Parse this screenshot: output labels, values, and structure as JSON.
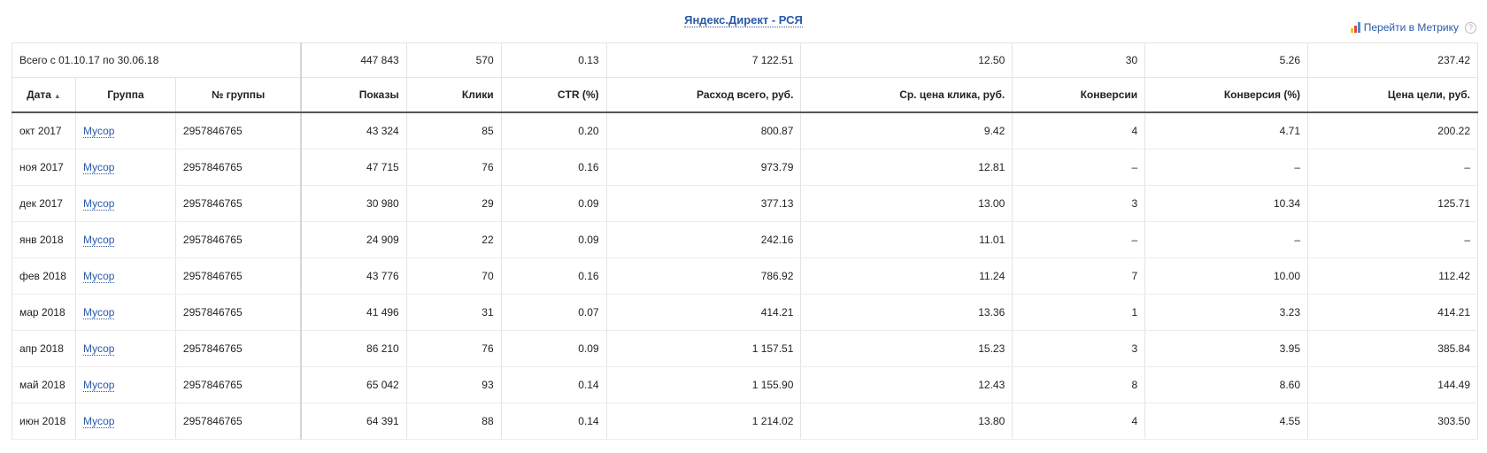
{
  "title": "Яндекс.Директ - РСЯ",
  "metrika_link": "Перейти в Метрику",
  "metrika_colors": [
    "#f0c419",
    "#e34a33",
    "#4b8bd6"
  ],
  "summary": {
    "label": "Всего с 01.10.17 по 30.06.18",
    "impressions": "447 843",
    "clicks": "570",
    "ctr": "0.13",
    "spend": "7 122.51",
    "avg_cpc": "12.50",
    "conversions": "30",
    "conversion_rate": "5.26",
    "cost_per_goal": "237.42"
  },
  "columns": {
    "date": "Дата",
    "date_sort": "▲",
    "group": "Группа",
    "group_id": "№ группы",
    "impressions": "Показы",
    "clicks": "Клики",
    "ctr": "CTR (%)",
    "spend": "Расход всего, руб.",
    "avg_cpc": "Ср. цена клика, руб.",
    "conversions": "Конверсии",
    "conversion_rate": "Конверсия (%)",
    "cost_per_goal": "Цена цели, руб."
  },
  "rows": [
    {
      "date": "окт 2017",
      "group": "Мусор",
      "group_id": "2957846765",
      "impressions": "43 324",
      "clicks": "85",
      "ctr": "0.20",
      "spend": "800.87",
      "avg_cpc": "9.42",
      "conversions": "4",
      "conversion_rate": "4.71",
      "cost_per_goal": "200.22"
    },
    {
      "date": "ноя 2017",
      "group": "Мусор",
      "group_id": "2957846765",
      "impressions": "47 715",
      "clicks": "76",
      "ctr": "0.16",
      "spend": "973.79",
      "avg_cpc": "12.81",
      "conversions": "–",
      "conversion_rate": "–",
      "cost_per_goal": "–"
    },
    {
      "date": "дек 2017",
      "group": "Мусор",
      "group_id": "2957846765",
      "impressions": "30 980",
      "clicks": "29",
      "ctr": "0.09",
      "spend": "377.13",
      "avg_cpc": "13.00",
      "conversions": "3",
      "conversion_rate": "10.34",
      "cost_per_goal": "125.71"
    },
    {
      "date": "янв 2018",
      "group": "Мусор",
      "group_id": "2957846765",
      "impressions": "24 909",
      "clicks": "22",
      "ctr": "0.09",
      "spend": "242.16",
      "avg_cpc": "11.01",
      "conversions": "–",
      "conversion_rate": "–",
      "cost_per_goal": "–"
    },
    {
      "date": "фев 2018",
      "group": "Мусор",
      "group_id": "2957846765",
      "impressions": "43 776",
      "clicks": "70",
      "ctr": "0.16",
      "spend": "786.92",
      "avg_cpc": "11.24",
      "conversions": "7",
      "conversion_rate": "10.00",
      "cost_per_goal": "112.42"
    },
    {
      "date": "мар 2018",
      "group": "Мусор",
      "group_id": "2957846765",
      "impressions": "41 496",
      "clicks": "31",
      "ctr": "0.07",
      "spend": "414.21",
      "avg_cpc": "13.36",
      "conversions": "1",
      "conversion_rate": "3.23",
      "cost_per_goal": "414.21"
    },
    {
      "date": "апр 2018",
      "group": "Мусор",
      "group_id": "2957846765",
      "impressions": "86 210",
      "clicks": "76",
      "ctr": "0.09",
      "spend": "1 157.51",
      "avg_cpc": "15.23",
      "conversions": "3",
      "conversion_rate": "3.95",
      "cost_per_goal": "385.84"
    },
    {
      "date": "май 2018",
      "group": "Мусор",
      "group_id": "2957846765",
      "impressions": "65 042",
      "clicks": "93",
      "ctr": "0.14",
      "spend": "1 155.90",
      "avg_cpc": "12.43",
      "conversions": "8",
      "conversion_rate": "8.60",
      "cost_per_goal": "144.49"
    },
    {
      "date": "июн 2018",
      "group": "Мусор",
      "group_id": "2957846765",
      "impressions": "64 391",
      "clicks": "88",
      "ctr": "0.14",
      "spend": "1 214.02",
      "avg_cpc": "13.80",
      "conversions": "4",
      "conversion_rate": "4.55",
      "cost_per_goal": "303.50"
    }
  ]
}
